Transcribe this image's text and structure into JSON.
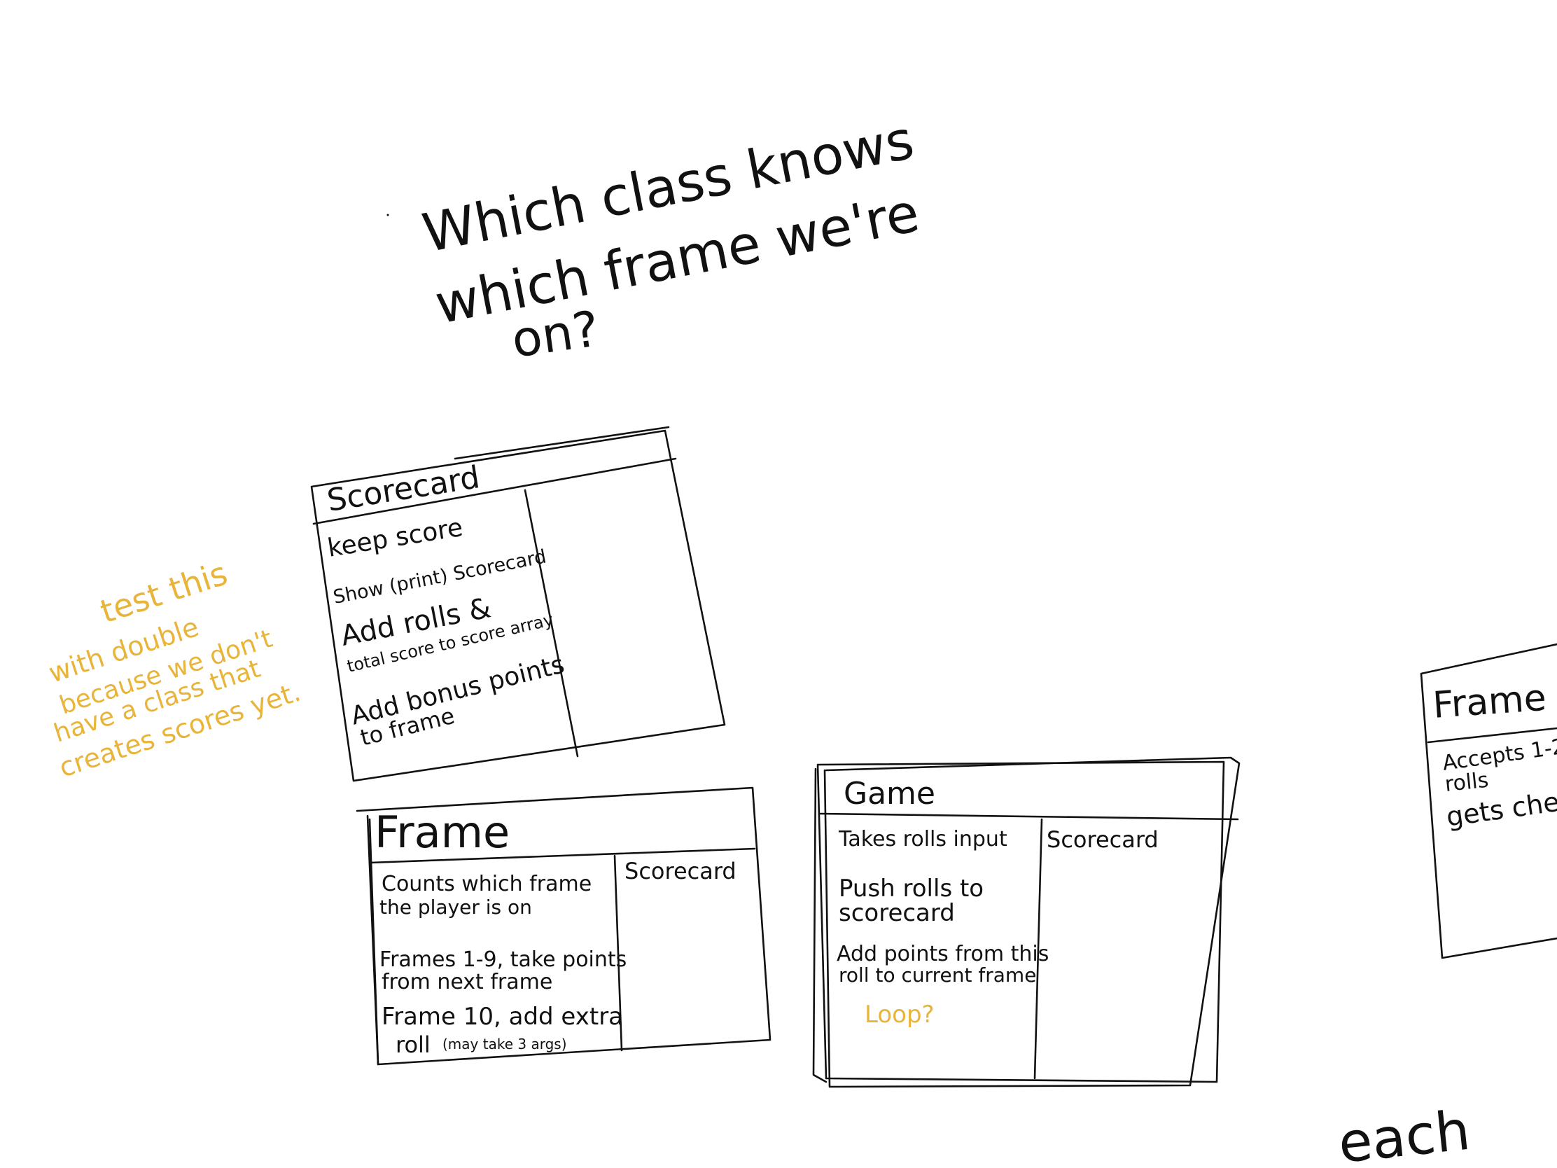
{
  "question": {
    "line1": "Which class knows",
    "line2": "which frame we're",
    "line3": "on?"
  },
  "annotation": {
    "line1": "test this",
    "line2": "with double",
    "line3": "because we don't",
    "line4": "have a class that",
    "line5": "creates scores yet."
  },
  "crc_cards": {
    "scorecard": {
      "title": "Scorecard",
      "responsibilities": [
        "keep score",
        "Show (print) Scorecard",
        "Add rolls &",
        "total score to score array",
        "Add bonus points",
        "to frame"
      ],
      "collaborators": []
    },
    "frame": {
      "title": "Frame",
      "responsibilities": [
        "Counts which frame",
        "the player is on",
        "Frames 1-9, take points",
        "from next frame",
        "Frame 10, add extra",
        "roll",
        "(may take 3 args)"
      ],
      "collaborators": [
        "Scorecard"
      ]
    },
    "game": {
      "title": "Game",
      "responsibilities": [
        "Takes rolls input",
        "Push rolls to",
        "scorecard",
        "Add points from this",
        "roll to current frame"
      ],
      "note": "Loop?",
      "collaborators": [
        "Scorecard"
      ]
    },
    "frame_partial": {
      "title": "Frame",
      "responsibilities": [
        "Accepts 1-2",
        "rolls",
        "gets che"
      ]
    }
  },
  "stray_word": "each",
  "colors": {
    "ink": "#111111",
    "highlight": "#e8b53a",
    "background": "#ffffff"
  }
}
